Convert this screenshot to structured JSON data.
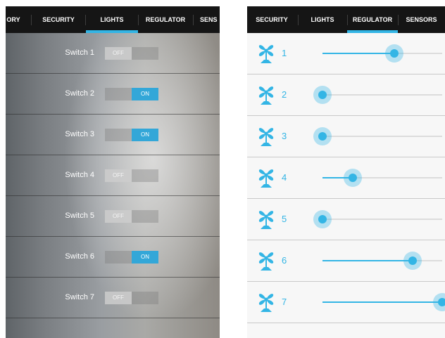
{
  "left_screen": {
    "tabs": [
      {
        "label": "ORY",
        "selected": false
      },
      {
        "label": "SECURITY",
        "selected": false
      },
      {
        "label": "LIGHTS",
        "selected": true
      },
      {
        "label": "REGULATOR",
        "selected": false
      },
      {
        "label": "SENS",
        "selected": false
      }
    ],
    "switches": [
      {
        "label": "Switch 1",
        "state": "OFF"
      },
      {
        "label": "Switch 2",
        "state": "ON"
      },
      {
        "label": "Switch 3",
        "state": "ON"
      },
      {
        "label": "Switch 4",
        "state": "OFF"
      },
      {
        "label": "Switch 5",
        "state": "OFF"
      },
      {
        "label": "Switch 6",
        "state": "ON"
      },
      {
        "label": "Switch 7",
        "state": "OFF"
      }
    ]
  },
  "right_screen": {
    "tabs": [
      {
        "label": "SECURITY",
        "selected": false
      },
      {
        "label": "LIGHTS",
        "selected": false
      },
      {
        "label": "REGULATOR",
        "selected": true
      },
      {
        "label": "SENSORS",
        "selected": false
      }
    ],
    "regulators": [
      {
        "label": "1",
        "icon": "fan-icon",
        "level": 0.6
      },
      {
        "label": "2",
        "icon": "fan-icon",
        "level": 0.0
      },
      {
        "label": "3",
        "icon": "fan-icon",
        "level": 0.0
      },
      {
        "label": "4",
        "icon": "fan-icon",
        "level": 0.25
      },
      {
        "label": "5",
        "icon": "fan-icon",
        "level": 0.0
      },
      {
        "label": "6",
        "icon": "fan-icon",
        "level": 0.75
      },
      {
        "label": "7",
        "icon": "fan-icon",
        "level": 1.0
      }
    ]
  },
  "colors": {
    "accent": "#33b5e5",
    "tab_bar": "#151515",
    "toggle_on": "#33a7d8"
  }
}
